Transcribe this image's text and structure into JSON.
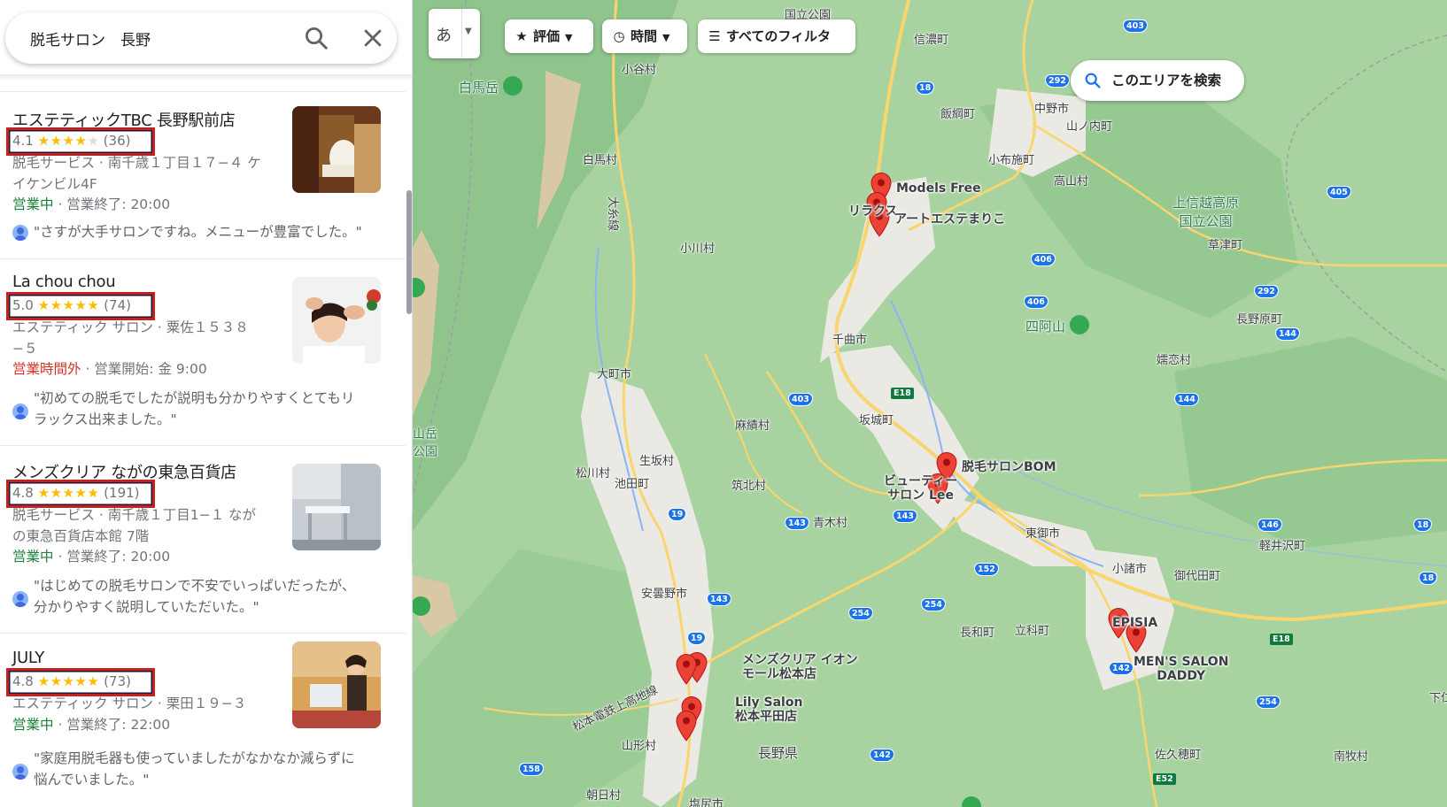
{
  "search": {
    "query": "脱毛サロン　長野"
  },
  "results": [
    {
      "name": "エステティックTBC 長野駅前店",
      "rating": "4.1",
      "stars": "★★★★",
      "stars_empty": "★",
      "count": "(36)",
      "address_lines": [
        "脱毛サービス · 南千歳１丁目１７−４ ケ",
        "イケンビル4F"
      ],
      "status": "営業中",
      "status_kind": "open",
      "hours": "営業終了: 20:00",
      "review": "\"さすが大手サロンですね。メニューが豊富でした。\""
    },
    {
      "name": "La chou chou",
      "rating": "5.0",
      "stars": "★★★★★",
      "stars_empty": "",
      "count": "(74)",
      "address_lines": [
        "エステティック サロン · 粟佐１５３８",
        "−５"
      ],
      "status": "営業時間外",
      "status_kind": "closed",
      "hours": "営業開始: 金 9:00",
      "review_lines": [
        "\"初めての脱毛でしたが説明も分かりやすくとてもリ",
        "ラックス出来ました。\""
      ]
    },
    {
      "name": "メンズクリア ながの東急百貨店",
      "rating": "4.8",
      "stars": "★★★★★",
      "stars_empty": "",
      "count": "(191)",
      "address_lines": [
        "脱毛サービス · 南千歳１丁目1−１ なが",
        "の東急百貨店本館 7階"
      ],
      "status": "営業中",
      "status_kind": "open",
      "hours": "営業終了: 20:00",
      "review_lines": [
        "\"はじめての脱毛サロンで不安でいっぱいだったが、",
        "分かりやすく説明していただいた。\""
      ]
    },
    {
      "name": "JULY",
      "rating": "4.8",
      "stars": "★★★★★",
      "stars_empty": "",
      "count": "(73)",
      "address_lines": [
        "エステティック サロン · 栗田１９−３"
      ],
      "status": "営業中",
      "status_kind": "open",
      "hours": "営業終了: 22:00",
      "review_lines": [
        "\"家庭用脱毛器も使っていましたがなかなか減らずに",
        "悩んでいました。\""
      ]
    }
  ],
  "map": {
    "lang_label": "あ",
    "chips": {
      "rating": "評価",
      "hours": "時間",
      "filters": "すべてのフィルタ"
    },
    "search_area": "このエリアを検索",
    "places": {
      "kokuritsu_koen": "国立公園",
      "shinanomachi": "信濃町",
      "otari": "小谷村",
      "hakuba_mt": "白馬岳",
      "iizuna": "飯綱町",
      "nakano": "中野市",
      "yamanouchi": "山ノ内町",
      "hakuba": "白馬村",
      "obuse": "小布施町",
      "takayama": "高山村",
      "joshinetsu": "上信越高原\n国立公園",
      "kusatsu": "草津町",
      "ogawa": "小川村",
      "shiaoyama": "四阿山",
      "naganohara": "長野原町",
      "chikuma": "千曲市",
      "omachi": "大町市",
      "tsumagoi": "嬬恋村",
      "asahi_yama": "山岳\n公園",
      "omi": "麻績村",
      "sakaki": "坂城町",
      "ikusaka": "生坂村",
      "matsukawa": "松川村",
      "ikeda": "池田町",
      "chikuhoku": "筑北村",
      "aoki": "青木村",
      "tomi": "東御市",
      "karuizawa": "軽井沢町",
      "komoro": "小諸市",
      "miyota": "御代田町",
      "azumino": "安曇野市",
      "nagawa": "長和町",
      "tateshina": "立科町",
      "yamagata": "山形村",
      "nagano_pref": "長野県",
      "sakuho": "佐久穂町",
      "minamimaki": "南牧村",
      "asahi": "朝日村",
      "shiojiri": "塩尻市",
      "shimonita": "下仁",
      "oitoline": "大糸線",
      "matsumoto_line": "松本電鉄上高地線",
      "hakuba_tree": "白馬岳"
    },
    "pins": {
      "models_free": "Models Free",
      "relax": "リラクス",
      "art_este": "アートエステまりこ",
      "bom": "脱毛サロンBOM",
      "beauty": "ビューティー\nサロン Lee",
      "mensclear_aeon": "メンズクリア イオン\nモール松本店",
      "lily": "Lily Salon\n松本平田店",
      "episia": "EPISIA",
      "mens_salon": "MEN'S SALON\nDADDY"
    },
    "colors": {
      "pin": "#ea4335",
      "road": "#f9d56e",
      "green": "#a8d3a0",
      "urban": "#ebe9e4"
    }
  }
}
